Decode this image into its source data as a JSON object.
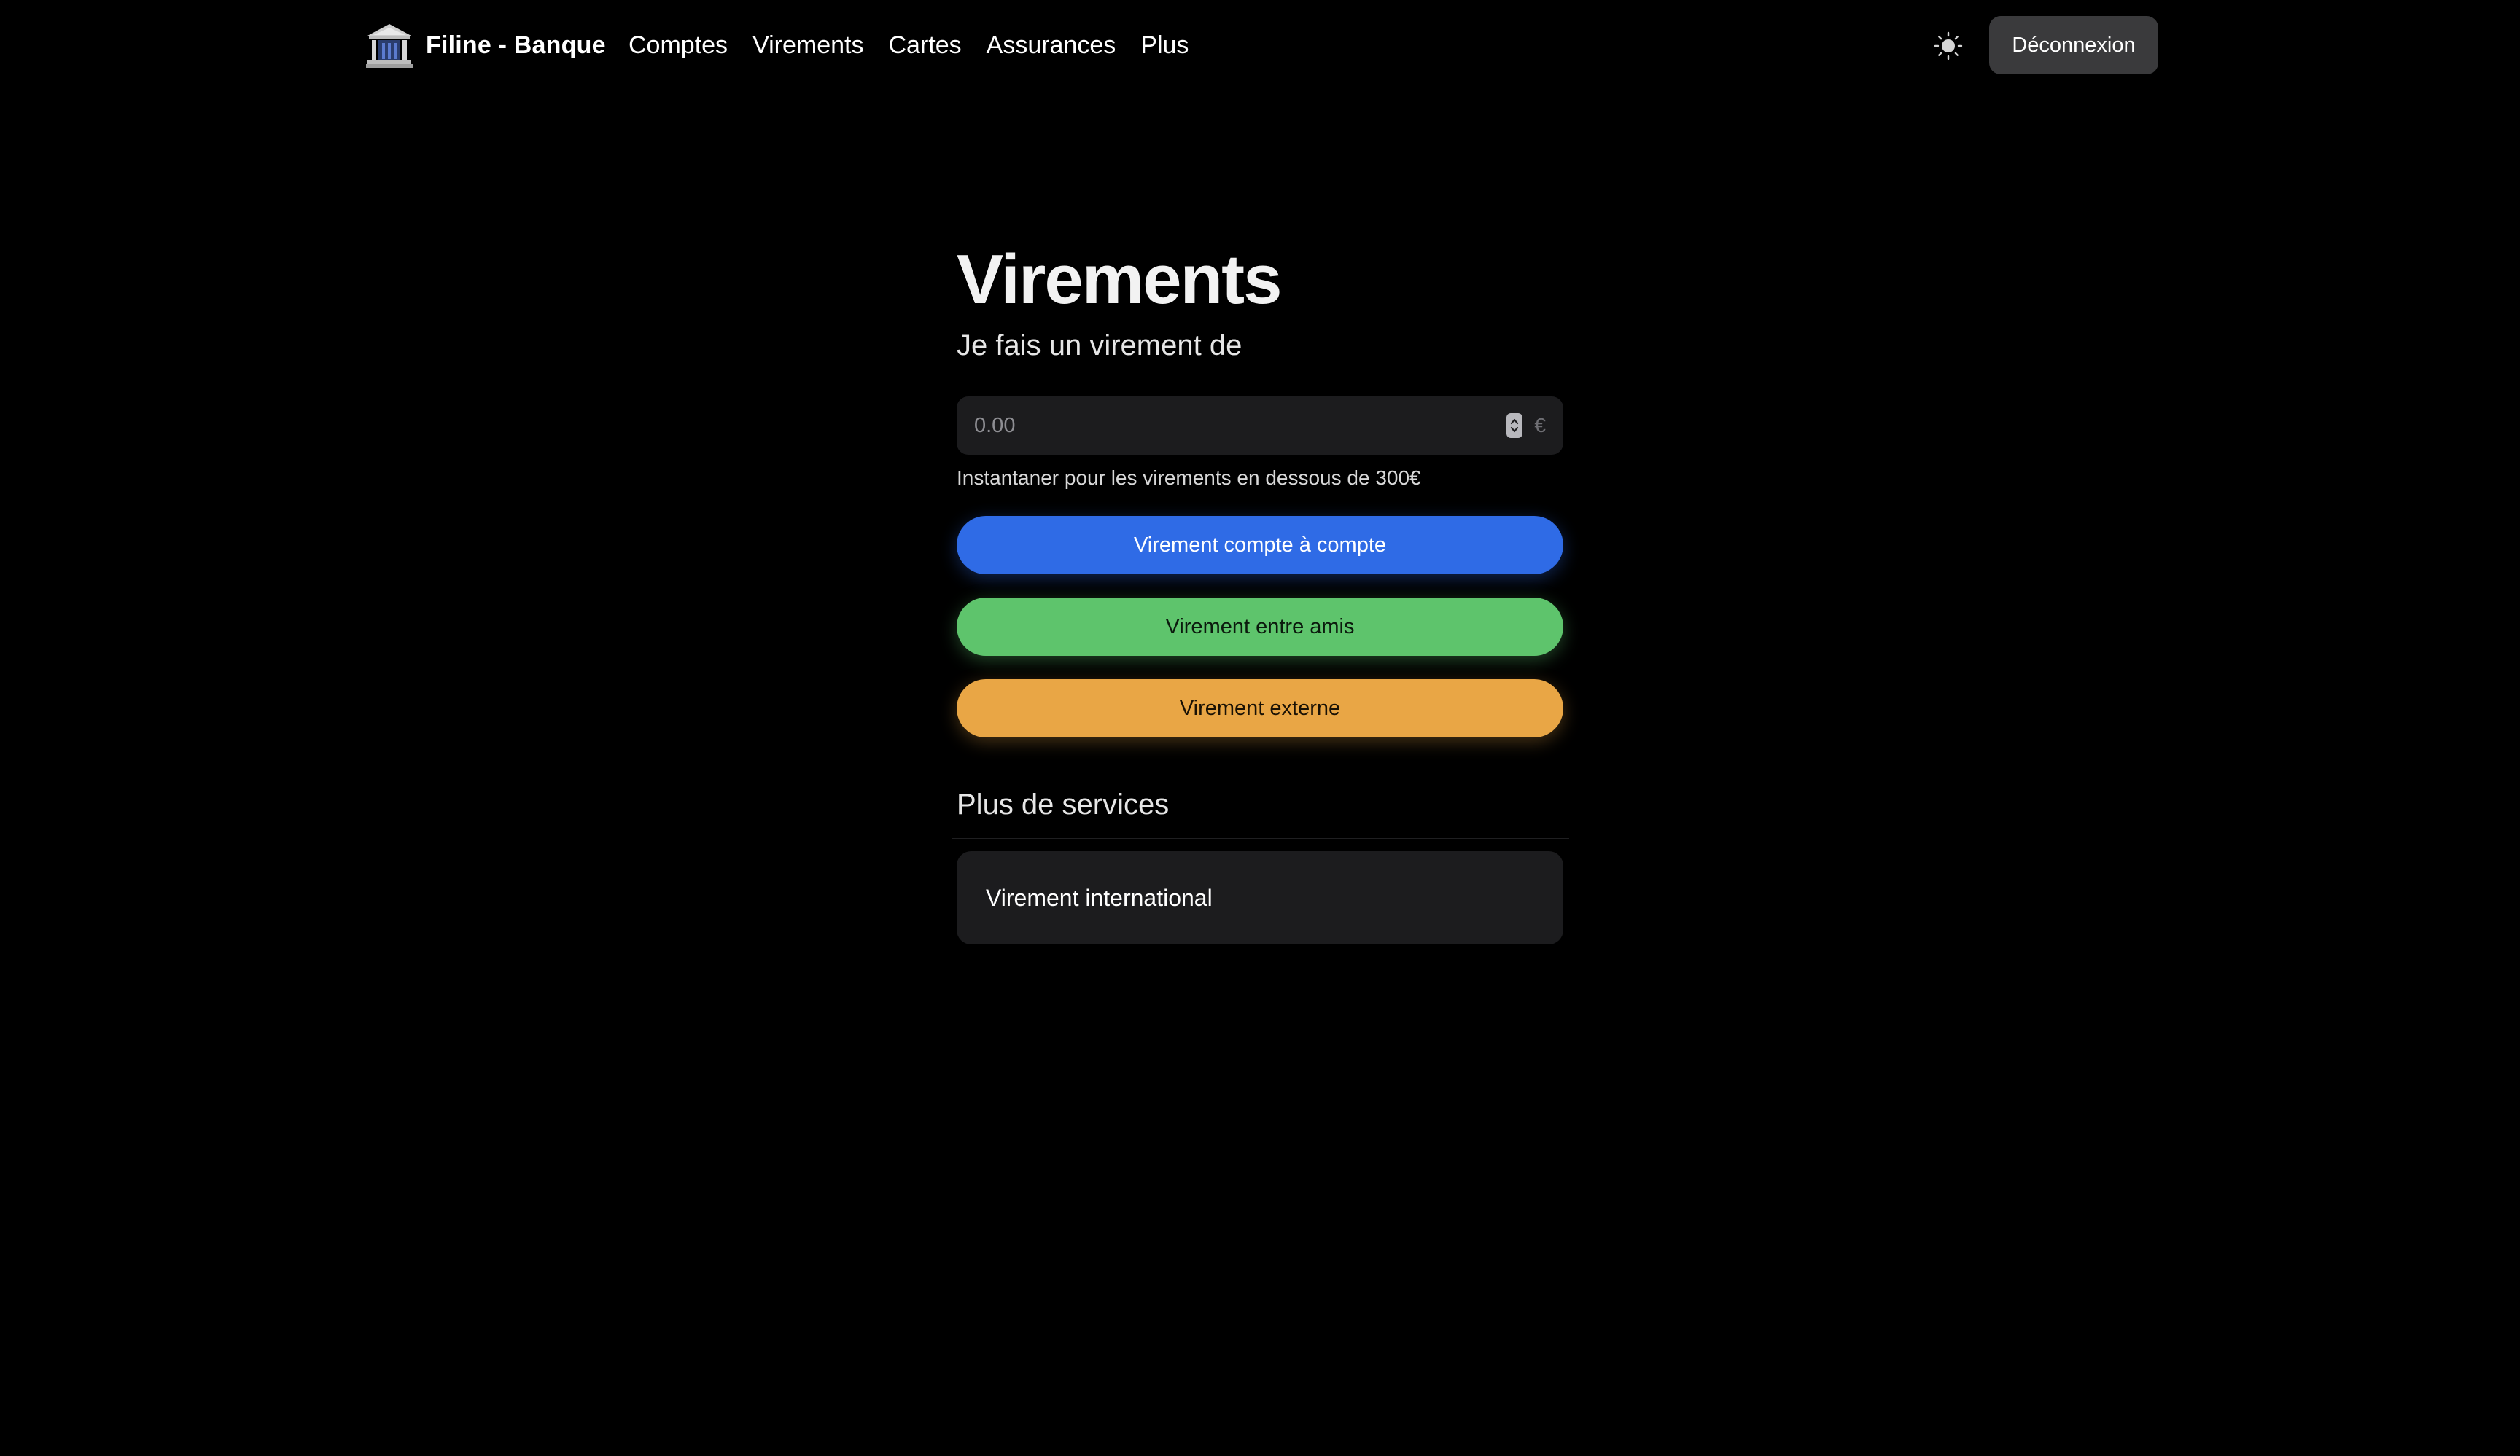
{
  "app": {
    "brand_name": "Filine - Banque",
    "logo_icon": "bank-building-icon"
  },
  "nav": {
    "items": [
      {
        "label": "Comptes"
      },
      {
        "label": "Virements"
      },
      {
        "label": "Cartes"
      },
      {
        "label": "Assurances"
      },
      {
        "label": "Plus"
      }
    ],
    "theme_toggle_icon": "sun-icon",
    "logout_label": "Déconnexion"
  },
  "page": {
    "title": "Virements",
    "subtitle": "Je fais un virement de"
  },
  "amount": {
    "placeholder": "0.00",
    "currency": "€",
    "help_text": "Instantaner pour les virements en dessous de 300€"
  },
  "actions": [
    {
      "label": "Virement compte à compte",
      "color": "#2f6be6"
    },
    {
      "label": "Virement entre amis",
      "color": "#5ec46c"
    },
    {
      "label": "Virement externe",
      "color": "#e9a645"
    }
  ],
  "services": {
    "title": "Plus de services",
    "items": [
      {
        "label": "Virement international"
      }
    ]
  },
  "colors": {
    "background": "#000000",
    "surface": "#1c1c1e",
    "logout_bg": "#3a3a3c"
  }
}
